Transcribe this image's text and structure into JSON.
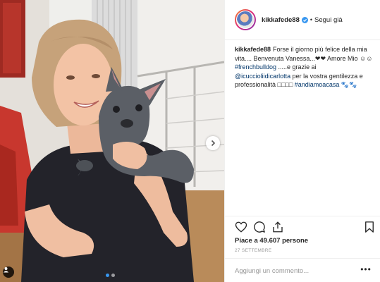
{
  "header": {
    "username": "kikkafede88",
    "separator": "•",
    "follow_label": "Segui già"
  },
  "caption": {
    "username": "kikkafede88",
    "text_1": "Forse il giorno più felice della mia vita.... Benvenuta Vanessa...❤❤ Amore Mio ☺☺ ",
    "hashtag_1": "#frenchbulldog",
    "text_2": " .....e grazie ai ",
    "mention": "@icuccioliidicarlotta",
    "text_3": " per la vostra gentilezza e professionalità □□□□ ",
    "hashtag_2": "#andiamoacasa",
    "text_4": " 🐾🐾"
  },
  "actions": {
    "like_icon": "heart-icon",
    "comment_icon": "comment-icon",
    "share_icon": "share-icon",
    "save_icon": "bookmark-icon"
  },
  "likes": "Piace a 49.607 persone",
  "date": "27 SETTEMBRE",
  "comment": {
    "placeholder": "Aggiungi un commento...",
    "more_label": "•••"
  },
  "carousel": {
    "total": 2,
    "active_index": 0
  },
  "colors": {
    "verified": "#3897f0",
    "link": "#003569",
    "border": "#efefef",
    "muted": "#999999"
  }
}
